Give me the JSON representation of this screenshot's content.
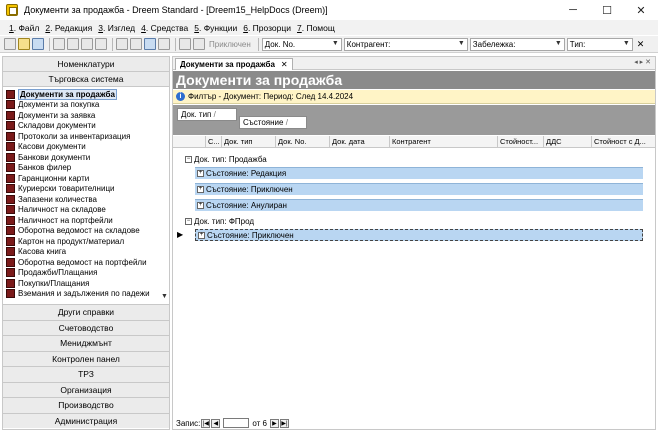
{
  "window": {
    "title": "Документи за продажба - Dreem Standard - [Dreem15_HelpDocs (Dreem)]",
    "minimize": "─",
    "maximize": "☐",
    "close": "✕"
  },
  "menu": [
    {
      "key": "1",
      "label": ". Файл"
    },
    {
      "key": "2",
      "label": ". Редакция"
    },
    {
      "key": "3",
      "label": ". Изглед"
    },
    {
      "key": "4",
      "label": ". Средства"
    },
    {
      "key": "5",
      "label": ". Функции"
    },
    {
      "key": "6",
      "label": ". Прозорци"
    },
    {
      "key": "7",
      "label": ". Помощ"
    }
  ],
  "toolbar": {
    "disabled_label": "Приключен",
    "doc_no_label": "Док. No.",
    "contractor_label": "Контрагент:",
    "note_label": "Забележка:",
    "type_label": "Тип:",
    "clear": "✕"
  },
  "leftnav": {
    "header": "Номенклатури",
    "section": "Търговска система",
    "items": [
      "Документи за продажба",
      "Документи за покупка",
      "Документи за заявка",
      "Складови документи",
      "Протоколи за инвентаризация",
      "Касови документи",
      "Банкови документи",
      "Банков филер",
      "Гаранционни карти",
      "Куриерски товарителници",
      "Запазени количества",
      "Наличност на складове",
      "Наличност на портфейли",
      "Оборотна ведомост на складове",
      "Картон на продукт/материал",
      "Касова книга",
      "Оборотна ведомост на портфейли",
      "Продажби/Плащания",
      "Покупки/Плащания",
      "Вземания и задължения по падежи"
    ],
    "groups": [
      "Други справки",
      "Счетоводство",
      "Мениджмънт",
      "Контролен панел",
      "ТРЗ",
      "Организация",
      "Производство",
      "Администрация"
    ]
  },
  "main": {
    "tab_label": "Документи за продажба",
    "tab_close": "✕",
    "tab_nav": "◂ ▸ ✕",
    "banner": "Документи за продажба",
    "filter": "Филтър - Документ: Период: След 14.4.2024",
    "group_chips": [
      "Док. тип",
      "Състояние"
    ],
    "columns": [
      "С...",
      "Док. тип",
      "Док. No.",
      "Док. дата",
      "Контрагент",
      "Стойност...",
      "ДДС",
      "Стойност с Д..."
    ],
    "groups": [
      {
        "label": "Док. тип: Продажба",
        "subs": [
          "Състояние: Редакция",
          "Състояние: Приключен",
          "Състояние: Анулиран"
        ]
      },
      {
        "label": "Док. тип: ФПрод",
        "subs": [
          "Състояние: Приключен"
        ]
      }
    ],
    "navigator": {
      "label": "Запис:",
      "of_text": "от 6"
    }
  }
}
